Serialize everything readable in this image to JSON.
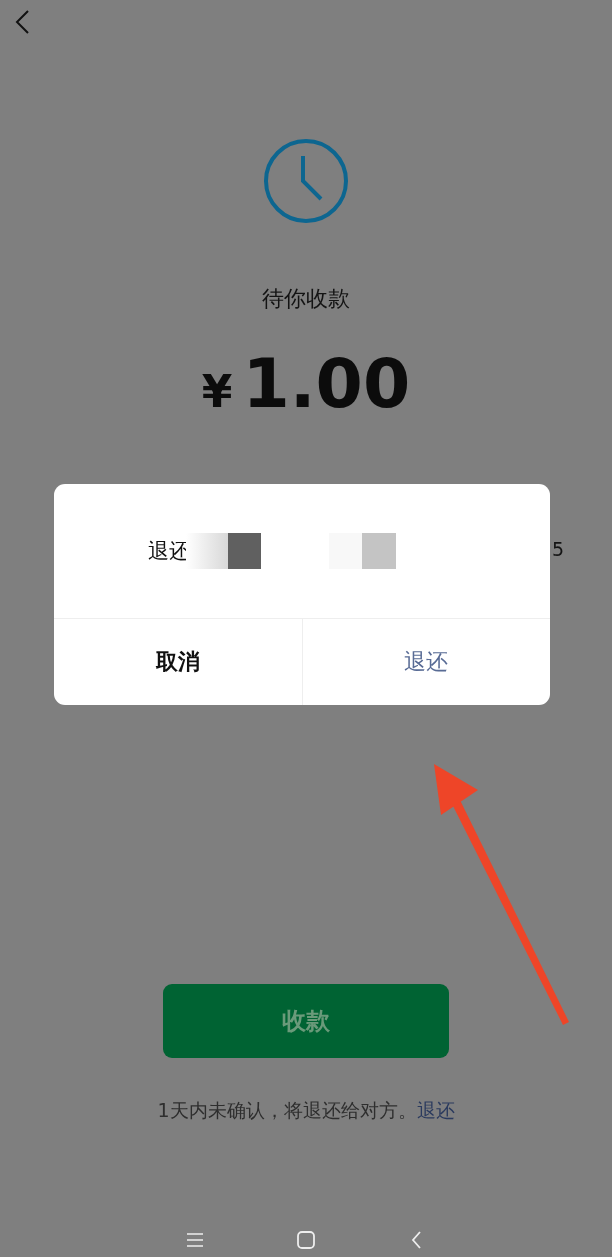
{
  "status": {
    "title": "待你收款",
    "currency": "¥",
    "amount": "1.00"
  },
  "details": {
    "trailing_value": "5"
  },
  "dialog": {
    "message": "退还",
    "buttons": [
      {
        "label": "取消",
        "kind": "cancel"
      },
      {
        "label": "退还",
        "kind": "confirm"
      }
    ]
  },
  "primary_button": {
    "label": "收款"
  },
  "footer": {
    "note": "1天内未确认，将退还给对方。",
    "link": "退还"
  }
}
